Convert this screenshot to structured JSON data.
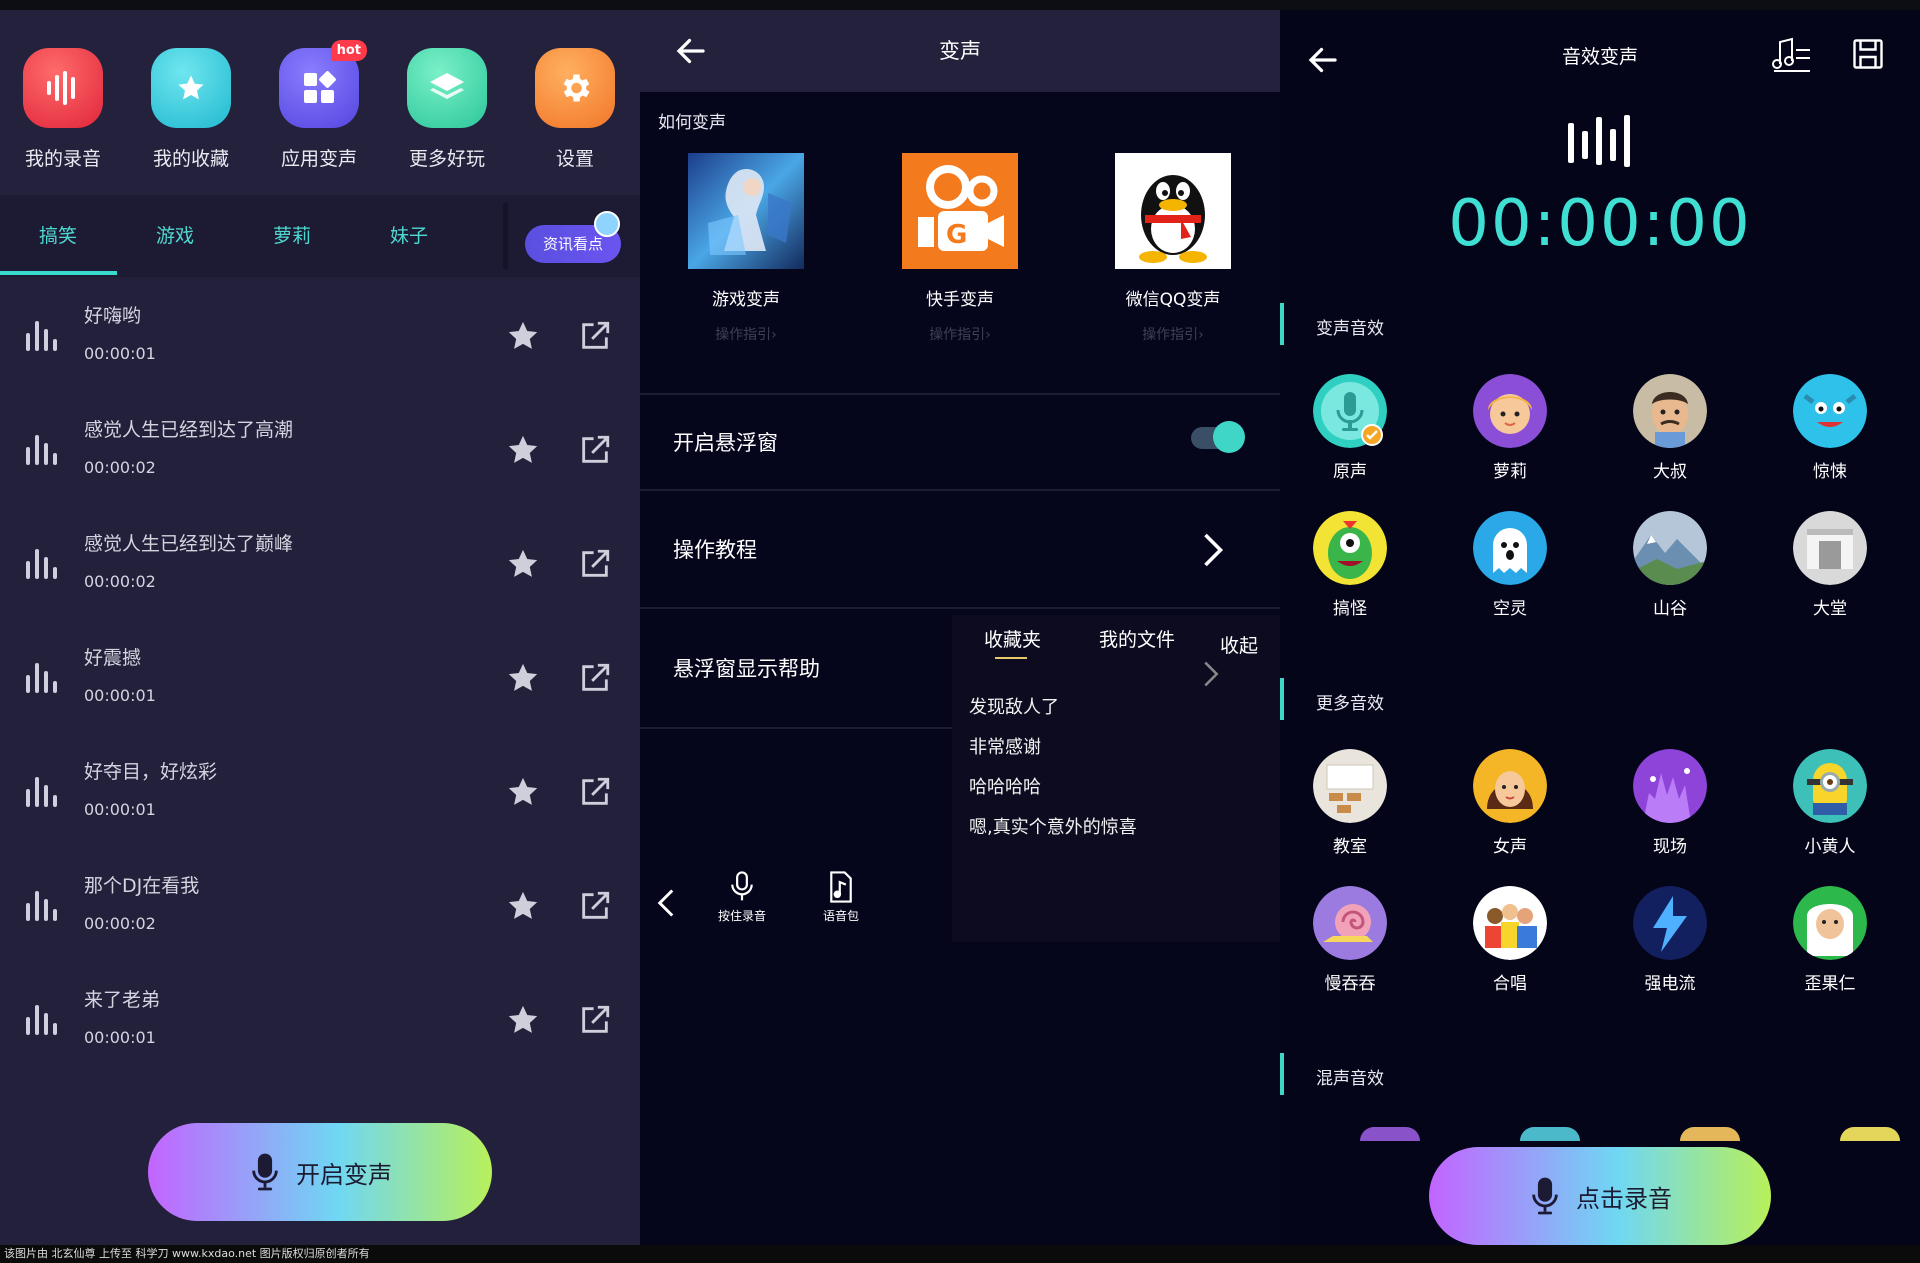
{
  "panel1": {
    "shortcuts": [
      {
        "label": "我的录音",
        "icon": "recording-icon",
        "color": "#f0414f"
      },
      {
        "label": "我的收藏",
        "icon": "star-icon",
        "color": "#3fd0e0"
      },
      {
        "label": "应用变声",
        "icon": "apps-icon",
        "color": "#6a5bea",
        "badge": "hot"
      },
      {
        "label": "更多好玩",
        "icon": "layers-icon",
        "color": "#3fd6a8"
      },
      {
        "label": "设置",
        "icon": "gear-icon",
        "color": "#ff8f3a"
      }
    ],
    "tabs": [
      "搞笑",
      "游戏",
      "萝莉",
      "妹子"
    ],
    "active_tab": "搞笑",
    "news_button": "资讯看点",
    "recordings": [
      {
        "title": "好嗨哟",
        "duration": "00:00:01"
      },
      {
        "title": "感觉人生已经到达了高潮",
        "duration": "00:00:02"
      },
      {
        "title": "感觉人生已经到达了巅峰",
        "duration": "00:00:02"
      },
      {
        "title": "好震撼",
        "duration": "00:00:01"
      },
      {
        "title": "好夺目，好炫彩",
        "duration": "00:00:01"
      },
      {
        "title": "那个DJ在看我",
        "duration": "00:00:02"
      },
      {
        "title": "来了老弟",
        "duration": "00:00:01"
      }
    ],
    "start_button": "开启变声"
  },
  "panel2": {
    "title": "变声",
    "how_title": "如何变声",
    "guides": [
      {
        "name": "游戏变声",
        "guide": "操作指引›",
        "icon": "game-art-icon"
      },
      {
        "name": "快手变声",
        "guide": "操作指引›",
        "icon": "kuaishou-icon"
      },
      {
        "name": "微信QQ变声",
        "guide": "操作指引›",
        "icon": "qq-penguin-icon"
      }
    ],
    "rows": {
      "float_window": "开启悬浮窗",
      "tutorial": "操作教程",
      "float_help": "悬浮窗显示帮助"
    },
    "float_window_on": true,
    "popup": {
      "tabs": [
        "收藏夹",
        "我的文件"
      ],
      "collapse": "收起",
      "items": [
        "发现敌人了",
        "非常感谢",
        "哈哈哈哈",
        "嗯,真实个意外的惊喜"
      ]
    },
    "tools": {
      "hold_record": "按住录音",
      "voice_pack": "语音包"
    }
  },
  "panel3": {
    "title": "音效变声",
    "timer": "00:00:00",
    "sections": {
      "voice": "变声音效",
      "more": "更多音效",
      "mix": "混声音效"
    },
    "voice_effects": [
      {
        "label": "原声",
        "icon": "microphone-icon",
        "selected": true
      },
      {
        "label": "萝莉",
        "icon": "girl-avatar-icon"
      },
      {
        "label": "大叔",
        "icon": "uncle-avatar-icon"
      },
      {
        "label": "惊悚",
        "icon": "monster-icon"
      },
      {
        "label": "搞怪",
        "icon": "green-monster-icon"
      },
      {
        "label": "空灵",
        "icon": "ghost-icon"
      },
      {
        "label": "山谷",
        "icon": "valley-icon"
      },
      {
        "label": "大堂",
        "icon": "hall-icon"
      }
    ],
    "more_effects": [
      {
        "label": "教室",
        "icon": "classroom-icon"
      },
      {
        "label": "女声",
        "icon": "woman-avatar-icon"
      },
      {
        "label": "现场",
        "icon": "concert-icon"
      },
      {
        "label": "小黄人",
        "icon": "minion-icon"
      },
      {
        "label": "慢吞吞",
        "icon": "snail-icon"
      },
      {
        "label": "合唱",
        "icon": "choir-icon"
      },
      {
        "label": "强电流",
        "icon": "lightning-icon"
      },
      {
        "label": "歪果仁",
        "icon": "foreigner-icon"
      }
    ],
    "record_button": "点击录音"
  },
  "footer": "该图片由 北玄仙尊 上传至 科学刀 www.kxdao.net 图片版权归原创者所有"
}
